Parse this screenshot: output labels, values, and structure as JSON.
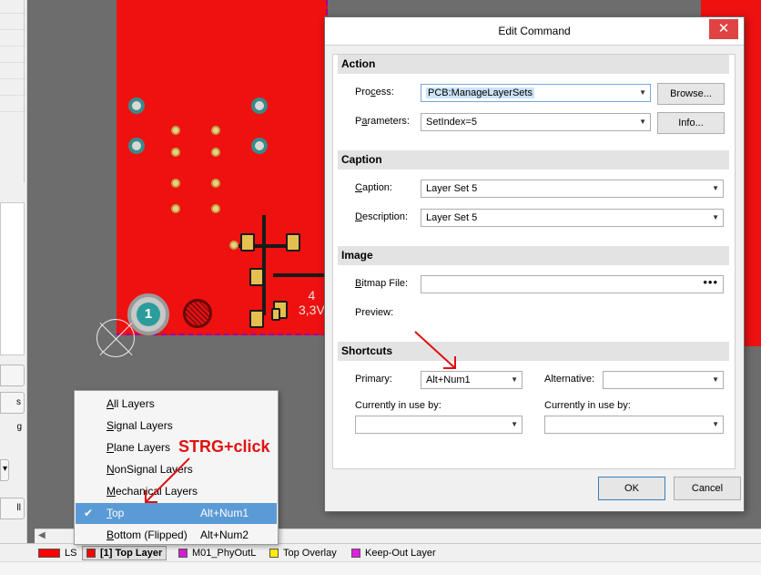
{
  "dialog": {
    "title": "Edit Command",
    "close_glyph": "✕",
    "sections": {
      "action": "Action",
      "caption": "Caption",
      "image": "Image",
      "shortcuts": "Shortcuts"
    },
    "action": {
      "process_label_pre": "Pro",
      "process_label_u": "c",
      "process_label_post": "ess:",
      "process_value": "PCB:ManageLayerSets",
      "parameters_label_pre": "P",
      "parameters_label_u": "a",
      "parameters_label_post": "rameters:",
      "parameters_value": "SetIndex=5",
      "browse_button": "Browse...",
      "info_button": "Info..."
    },
    "caption": {
      "caption_label_u": "C",
      "caption_label_post": "aption:",
      "caption_value": "Layer Set 5",
      "description_label_u": "D",
      "description_label_post": "escription:",
      "description_value": "Layer Set 5"
    },
    "image": {
      "bitmap_label_u": "B",
      "bitmap_label_post": "itmap File:",
      "bitmap_browse": "•••",
      "preview_label": "Preview:"
    },
    "shortcuts": {
      "primary_label": "Primary:",
      "primary_value": "Alt+Num1",
      "alternative_label": "Alternative:",
      "alternative_value": "",
      "in_use_label_1": "Currently in use by:",
      "in_use_value_1": "",
      "in_use_label_2": "Currently in use by:",
      "in_use_value_2": ""
    },
    "ok_button": "OK",
    "cancel_button": "Cancel",
    "arrow_glyph": "▼"
  },
  "layer_menu": {
    "items": [
      {
        "u": "A",
        "rest": "ll Layers",
        "shortcut": "",
        "checked": false
      },
      {
        "u": "S",
        "rest": "ignal Layers",
        "shortcut": "",
        "checked": false
      },
      {
        "u": "P",
        "rest": "lane Layers",
        "shortcut": "",
        "checked": false
      },
      {
        "u": "N",
        "rest": "onSignal Layers",
        "shortcut": "",
        "checked": false
      },
      {
        "u": "M",
        "rest": "echanical Layers",
        "shortcut": "",
        "checked": false
      },
      {
        "u": "T",
        "rest": "op",
        "shortcut": "Alt+Num1",
        "checked": true
      },
      {
        "u": "B",
        "rest": "ottom (Flipped)",
        "shortcut": "Alt+Num2",
        "checked": false
      }
    ],
    "check_glyph": "✔"
  },
  "annotation": {
    "text": "STRG+click",
    "color": "#e01010"
  },
  "layer_tabs": [
    {
      "label": "LS",
      "color": "#ff0000"
    },
    {
      "label": "[1] Top Layer",
      "color": "#ff0000"
    },
    {
      "label": "M01_PhyOutL",
      "color": "#d020d0"
    },
    {
      "label": "Top Overlay",
      "color": "#ffee00"
    },
    {
      "label": "Keep-Out Layer",
      "color": "#e020e0"
    }
  ],
  "left_panel": {
    "btn1": "",
    "btn2": "s",
    "btn3": "g",
    "btn4": "▾",
    "btn5": "ll"
  },
  "pcb": {
    "pad_number": "1",
    "label_line1": "4",
    "label_line2": "3,3V",
    "scroll_arrow": "◀"
  }
}
